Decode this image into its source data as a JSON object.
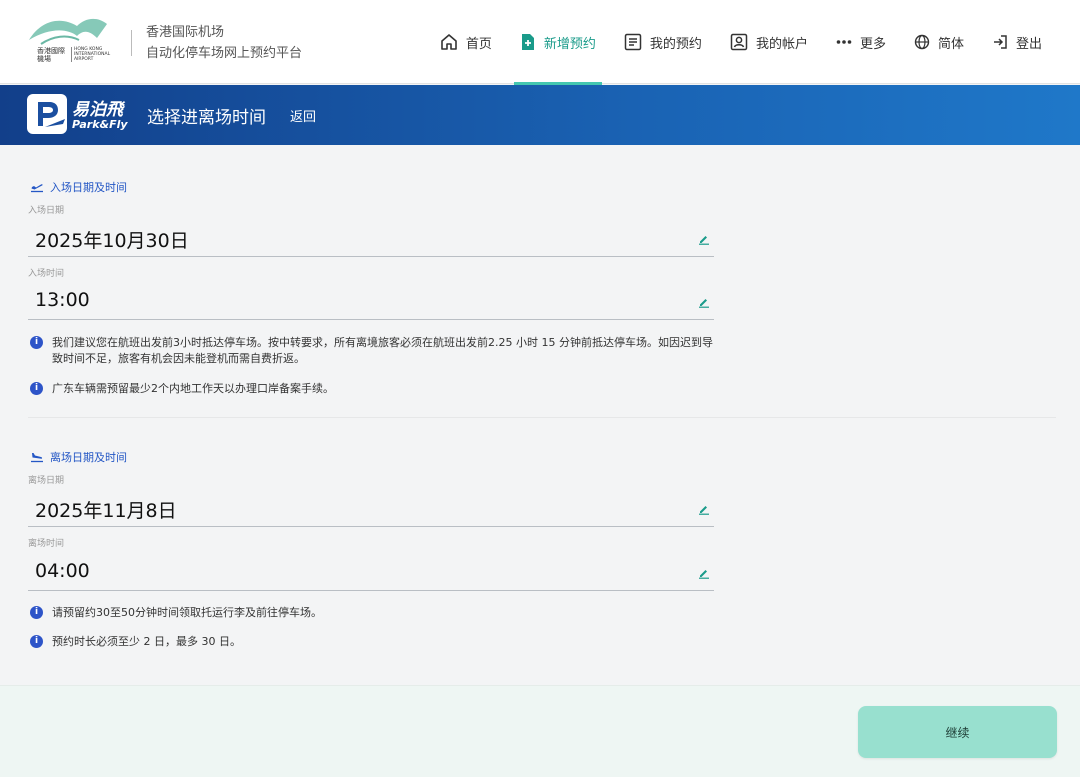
{
  "header": {
    "logo_text_cn": "香港國際機場",
    "logo_text_en": "HONG KONG INTERNATIONAL AIRPORT",
    "site_name_line1": "香港国际机场",
    "site_name_line2": "自动化停车场网上预约平台",
    "nav": [
      {
        "label": "首页",
        "icon": "home-icon"
      },
      {
        "label": "新增预约",
        "icon": "add-file-icon",
        "active": true
      },
      {
        "label": "我的预约",
        "icon": "list-icon"
      },
      {
        "label": "我的帐户",
        "icon": "account-icon"
      },
      {
        "label": "更多",
        "icon": "more-icon"
      },
      {
        "label": "简体",
        "icon": "globe-icon"
      },
      {
        "label": "登出",
        "icon": "logout-icon"
      }
    ]
  },
  "band": {
    "logo_cn": "易泊飛",
    "logo_en": "Park&Fly",
    "title": "选择进离场时间",
    "back_label": "返回"
  },
  "entry": {
    "heading": "入场日期及时间",
    "date_label": "入场日期",
    "date_value": "2025年10月30日",
    "time_label": "入场时间",
    "time_value": "13:00",
    "notes": [
      "我们建议您在航班出发前3小时抵达停车场。按中转要求，所有离境旅客必须在航班出发前2.25 小时 15 分钟前抵达停车场。如因迟到导致时间不足，旅客有机会因未能登机而需自费折返。",
      "广东车辆需预留最少2个内地工作天以办理口岸备案手续。"
    ]
  },
  "exit": {
    "heading": "离场日期及时间",
    "date_label": "离场日期",
    "date_value": "2025年11月8日",
    "time_label": "离场时间",
    "time_value": "04:00",
    "notes": [
      "请预留约30至50分钟时间领取托运行李及前往停车场。",
      "预约时长必须至少 2 日，最多 30 日。"
    ]
  },
  "footer": {
    "continue_label": "继续"
  },
  "colors": {
    "accent": "#45c7b0",
    "band_start": "#123f8a",
    "band_end": "#1f78c9",
    "info": "#2d54c8",
    "button": "#98e0cf"
  }
}
